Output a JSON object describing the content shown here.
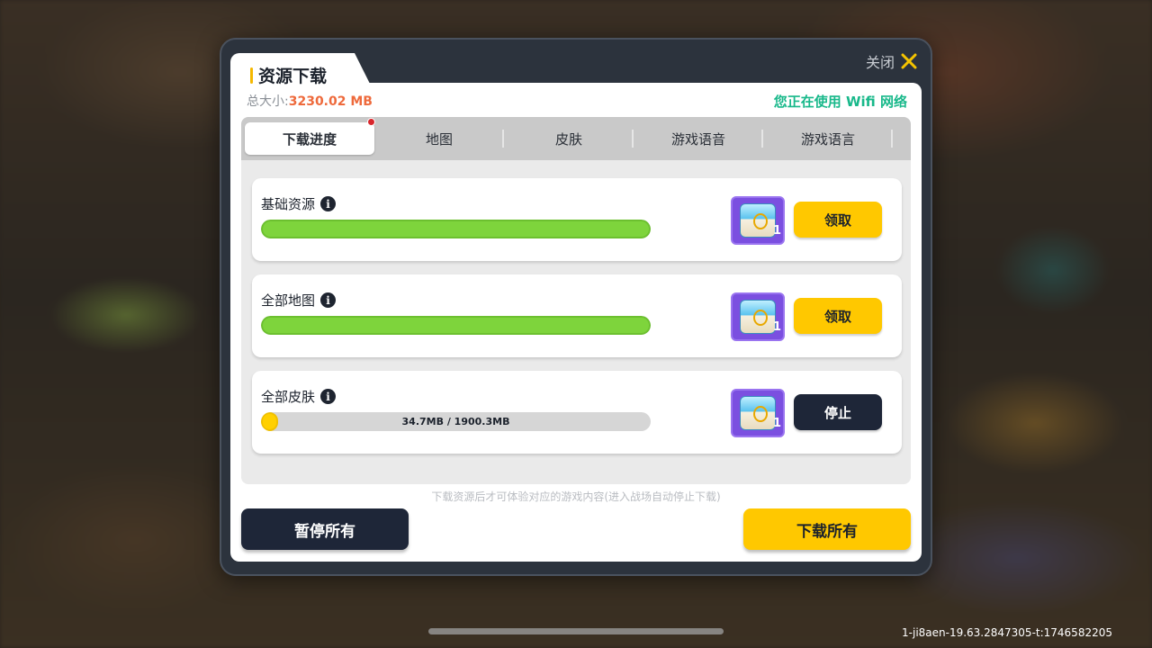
{
  "dialog": {
    "title": "资源下载",
    "close_label": "关闭",
    "total_size_label": "总大小:",
    "total_size_value": "3230.02 MB",
    "network_status": "您正在使用 Wifi 网络"
  },
  "tabs": [
    {
      "label": "下载进度",
      "active": true,
      "has_notification": true
    },
    {
      "label": "地图",
      "active": false
    },
    {
      "label": "皮肤",
      "active": false
    },
    {
      "label": "游戏语音",
      "active": false
    },
    {
      "label": "游戏语言",
      "active": false
    }
  ],
  "items": [
    {
      "label": "基础资源",
      "progress": 1.0,
      "progress_text": "",
      "reward_count": "1",
      "action_label": "领取",
      "action_style": "yellow"
    },
    {
      "label": "全部地图",
      "progress": 1.0,
      "progress_text": "",
      "reward_count": "1",
      "action_label": "领取",
      "action_style": "yellow"
    },
    {
      "label": "全部皮肤",
      "progress": 0.018,
      "progress_text": "34.7MB / 1900.3MB",
      "reward_count": "1",
      "action_label": "停止",
      "action_style": "dark"
    }
  ],
  "hint": "下载资源后才可体验对应的游戏内容(进入战场自动停止下载)",
  "footer": {
    "pause_all_label": "暂停所有",
    "download_all_label": "下载所有"
  },
  "build_info": "1-ji8aen-19.63.2847305-t:1746582205",
  "colors": {
    "accent_yellow": "#ffc800",
    "progress_green": "#7ed43c",
    "network_green": "#18b88a",
    "size_orange": "#ee6a3c",
    "dark_button": "#1e2638"
  }
}
